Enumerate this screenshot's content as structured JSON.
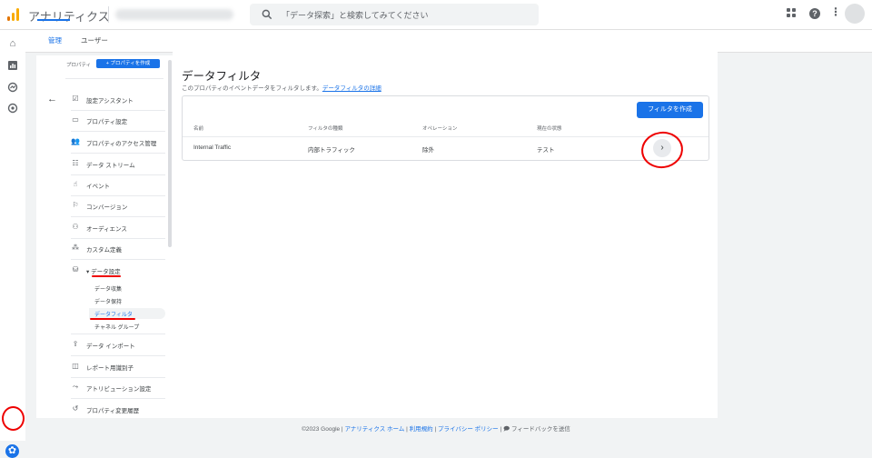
{
  "header": {
    "app_title": "アナリティクス",
    "search_placeholder": "「データ探索」と検索してみてください"
  },
  "rail": {
    "icons": [
      "home-icon",
      "reports-icon",
      "explore-icon",
      "advertising-icon"
    ],
    "settings_icon": "gear-icon"
  },
  "tabs": [
    {
      "label": "管理",
      "active": true
    },
    {
      "label": "ユーザー",
      "active": false
    }
  ],
  "nav": {
    "property_label": "プロパティ",
    "create_property_label": "+ プロパティを作成",
    "items": [
      {
        "icon": "checklist-icon",
        "label": "設定アシスタント"
      },
      {
        "icon": "property-settings-icon",
        "label": "プロパティ設定"
      },
      {
        "icon": "people-icon",
        "label": "プロパティのアクセス管理"
      },
      {
        "icon": "data-streams-icon",
        "label": "データ ストリーム"
      },
      {
        "icon": "events-icon",
        "label": "イベント"
      },
      {
        "icon": "flag-icon",
        "label": "コンバージョン"
      },
      {
        "icon": "audience-icon",
        "label": "オーディエンス"
      },
      {
        "icon": "custom-definitions-icon",
        "label": "カスタム定義"
      },
      {
        "icon": "database-icon",
        "label": "▾ データ設定"
      },
      {
        "icon": "upload-icon",
        "label": "データ インポート"
      },
      {
        "icon": "report-identity-icon",
        "label": "レポート用識別子"
      },
      {
        "icon": "attribution-icon",
        "label": "アトリビューション設定"
      },
      {
        "icon": "history-icon",
        "label": "プロパティ変更履歴"
      }
    ],
    "data_settings_subitems": [
      "データ収集",
      "データ保持",
      "データフィルタ",
      "チャネル グループ"
    ]
  },
  "main": {
    "title": "データフィルタ",
    "description": "このプロパティのイベントデータをフィルタします。",
    "description_link": "データフィルタの詳細",
    "create_filter_label": "フィルタを作成",
    "columns": [
      "名前",
      "フィルタの種類",
      "オペレーション",
      "現在の状態"
    ],
    "rows": [
      {
        "name": "Internal Traffic",
        "type": "内部トラフィック",
        "operation": "除外",
        "status": "テスト"
      }
    ]
  },
  "footer": {
    "copyright": "©2023 Google | ",
    "analytics_home": "アナリティクス ホーム",
    "terms": "利用規約",
    "privacy": "プライバシー ポリシー",
    "feedback": "フィードバックを送信"
  }
}
